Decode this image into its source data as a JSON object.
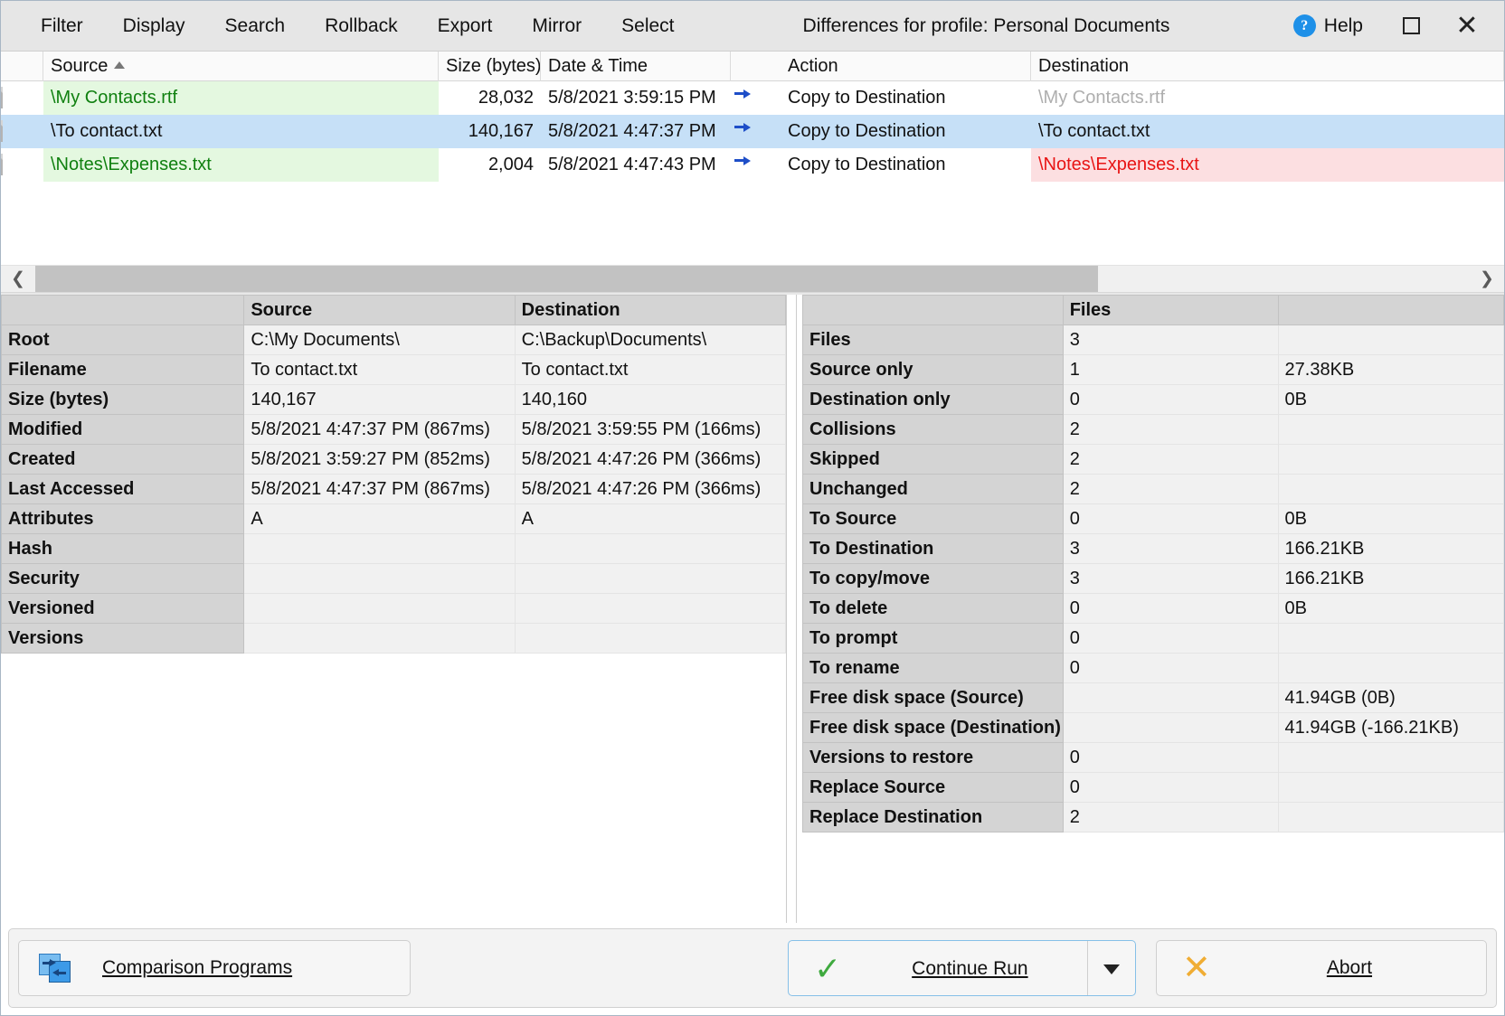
{
  "window": {
    "title": "Differences for profile: Personal Documents",
    "help_label": "Help",
    "maximize_icon": "maximize-icon",
    "close_icon": "close-icon",
    "close_glyph": "✕",
    "help_glyph": "?"
  },
  "menu": {
    "items": [
      {
        "label": "Filter"
      },
      {
        "label": "Display"
      },
      {
        "label": "Search"
      },
      {
        "label": "Rollback"
      },
      {
        "label": "Export"
      },
      {
        "label": "Mirror"
      },
      {
        "label": "Select"
      }
    ]
  },
  "filelist": {
    "columns": {
      "source": "Source",
      "size": "Size (bytes)",
      "datetime": "Date & Time",
      "action": "Action",
      "destination": "Destination"
    },
    "sort": {
      "column": "Source",
      "direction": "asc"
    },
    "rows": [
      {
        "source": "\\My Contacts.rtf",
        "size": "28,032",
        "datetime": "5/8/2021 3:59:15 PM",
        "action": "Copy to Destination",
        "destination": "\\My Contacts.rtf",
        "source_style": "green",
        "dest_style": "grey",
        "selected": false
      },
      {
        "source": "\\To contact.txt",
        "size": "140,167",
        "datetime": "5/8/2021 4:47:37 PM",
        "action": "Copy to Destination",
        "destination": "\\To contact.txt",
        "source_style": "plain",
        "dest_style": "plain",
        "selected": true
      },
      {
        "source": "\\Notes\\Expenses.txt",
        "size": "2,004",
        "datetime": "5/8/2021 4:47:43 PM",
        "action": "Copy to Destination",
        "destination": "\\Notes\\Expenses.txt",
        "source_style": "green",
        "dest_style": "pink",
        "selected": false
      }
    ]
  },
  "details": {
    "headers": {
      "blank": "",
      "source": "Source",
      "destination": "Destination"
    },
    "rows": [
      {
        "label": "Root",
        "source": "C:\\My Documents\\",
        "destination": "C:\\Backup\\Documents\\",
        "source_style": "plain",
        "dest_style": "plain"
      },
      {
        "label": "Filename",
        "source": "To contact.txt",
        "destination": "To contact.txt",
        "source_style": "plain",
        "dest_style": "plain"
      },
      {
        "label": "Size (bytes)",
        "source": "140,167",
        "destination": "140,160",
        "source_style": "green",
        "dest_style": "red"
      },
      {
        "label": "Modified",
        "source": "5/8/2021 4:47:37 PM (867ms)",
        "destination": "5/8/2021 3:59:55 PM (166ms)",
        "source_style": "green",
        "dest_style": "red"
      },
      {
        "label": "Created",
        "source": "5/8/2021 3:59:27 PM (852ms)",
        "destination": "5/8/2021 4:47:26 PM (366ms)",
        "source_style": "red",
        "dest_style": "green"
      },
      {
        "label": "Last Accessed",
        "source": "5/8/2021 4:47:37 PM (867ms)",
        "destination": "5/8/2021 4:47:26 PM (366ms)",
        "source_style": "green",
        "dest_style": "red"
      },
      {
        "label": "Attributes",
        "source": "A",
        "destination": "A",
        "source_style": "green",
        "dest_style": "green"
      },
      {
        "label": "Hash",
        "source": "",
        "destination": "",
        "source_style": "plain",
        "dest_style": "plain"
      },
      {
        "label": "Security",
        "source": "",
        "destination": "",
        "source_style": "plain",
        "dest_style": "plain"
      },
      {
        "label": "Versioned",
        "source": "",
        "destination": "",
        "source_style": "plain",
        "dest_style": "plain"
      },
      {
        "label": "Versions",
        "source": "",
        "destination": "",
        "source_style": "plain",
        "dest_style": "plain"
      }
    ]
  },
  "stats": {
    "headers": {
      "blank": "",
      "files": "Files",
      "size": ""
    },
    "rows": [
      {
        "label": "Files",
        "count": "3",
        "size": "",
        "count_style": "plain"
      },
      {
        "label": "Source only",
        "count": "1",
        "size": "27.38KB",
        "count_style": "plain"
      },
      {
        "label": "Destination only",
        "count": "0",
        "size": "0B",
        "count_style": "plain"
      },
      {
        "label": "Collisions",
        "count": "2",
        "size": "",
        "count_style": "red"
      },
      {
        "label": "Skipped",
        "count": "2",
        "size": "",
        "count_style": "plain"
      },
      {
        "label": "Unchanged",
        "count": "2",
        "size": "",
        "count_style": "plain"
      },
      {
        "label": "To Source",
        "count": "0",
        "size": "0B",
        "count_style": "plain"
      },
      {
        "label": "To Destination",
        "count": "3",
        "size": "166.21KB",
        "count_style": "plain"
      },
      {
        "label": "To copy/move",
        "count": "3",
        "size": "166.21KB",
        "count_style": "plain"
      },
      {
        "label": "To delete",
        "count": "0",
        "size": "0B",
        "count_style": "plain"
      },
      {
        "label": "To prompt",
        "count": "0",
        "size": "",
        "count_style": "plain"
      },
      {
        "label": "To rename",
        "count": "0",
        "size": "",
        "count_style": "plain"
      },
      {
        "label": "Free disk space (Source)",
        "count": "",
        "size": "41.94GB (0B)",
        "count_style": "plain"
      },
      {
        "label": "Free disk space (Destination)",
        "count": "",
        "size": "41.94GB (-166.21KB)",
        "count_style": "plain"
      },
      {
        "label": "Versions to restore",
        "count": "0",
        "size": "",
        "count_style": "plain"
      },
      {
        "label": "Replace Source",
        "count": "0",
        "size": "",
        "count_style": "plain"
      },
      {
        "label": "Replace Destination",
        "count": "2",
        "size": "",
        "count_style": "red"
      }
    ]
  },
  "footer": {
    "comparison_programs": "Comparison Programs",
    "continue_run": "Continue Run",
    "abort": "Abort"
  }
}
